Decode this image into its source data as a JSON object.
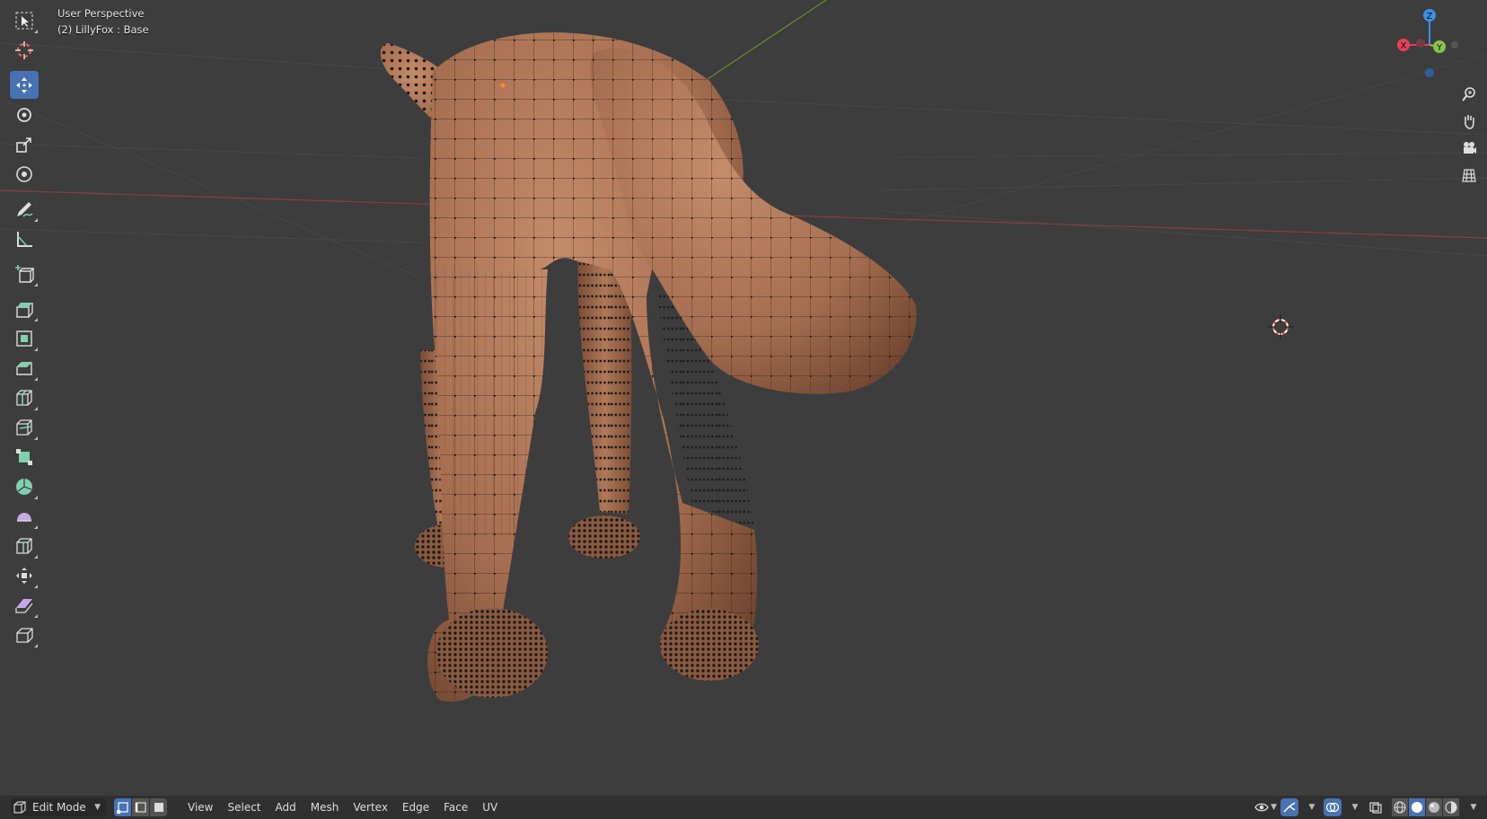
{
  "viewport": {
    "perspective_label": "User Perspective",
    "object_label": "(2) LillyFox : Base"
  },
  "toolbar": {
    "tools": [
      {
        "name": "select-box-tool",
        "icon": "cursor-box-icon",
        "active": false
      },
      {
        "name": "cursor-tool",
        "icon": "cursor-3d-icon",
        "active": false
      },
      {
        "name": "move-tool",
        "icon": "move-icon",
        "active": true
      },
      {
        "name": "rotate-tool",
        "icon": "rotate-icon",
        "active": false
      },
      {
        "name": "scale-tool",
        "icon": "scale-icon",
        "active": false
      },
      {
        "name": "transform-tool",
        "icon": "transform-icon",
        "active": false
      },
      {
        "name": "annotate-tool",
        "icon": "annotate-icon",
        "active": false
      },
      {
        "name": "measure-tool",
        "icon": "measure-icon",
        "active": false
      },
      {
        "name": "add-cube-tool",
        "icon": "add-cube-icon",
        "active": false
      },
      {
        "name": "extrude-region-tool",
        "icon": "extrude-icon",
        "active": false
      },
      {
        "name": "inset-faces-tool",
        "icon": "inset-icon",
        "active": false
      },
      {
        "name": "bevel-tool",
        "icon": "bevel-icon",
        "active": false
      },
      {
        "name": "loop-cut-tool",
        "icon": "loop-cut-icon",
        "active": false
      },
      {
        "name": "knife-tool",
        "icon": "knife-icon",
        "active": false
      },
      {
        "name": "poly-build-tool",
        "icon": "poly-build-icon",
        "active": false
      },
      {
        "name": "spin-tool",
        "icon": "spin-icon",
        "active": false
      },
      {
        "name": "smooth-tool",
        "icon": "smooth-icon",
        "active": false
      },
      {
        "name": "edge-slide-tool",
        "icon": "edge-slide-icon",
        "active": false
      },
      {
        "name": "shrink-fatten-tool",
        "icon": "shrink-fatten-icon",
        "active": false
      },
      {
        "name": "shear-tool",
        "icon": "shear-icon",
        "active": false
      },
      {
        "name": "rip-region-tool",
        "icon": "rip-icon",
        "active": false
      }
    ]
  },
  "gizmo": {
    "x_label": "X",
    "y_label": "Y",
    "z_label": "Z",
    "x_color": "#e8405a",
    "y_color": "#8bc34a",
    "z_color": "#3f8ee8"
  },
  "nav_buttons": [
    "zoom-icon",
    "pan-hand-icon",
    "camera-icon",
    "grid-ortho-icon"
  ],
  "header": {
    "mode": "Edit Mode",
    "select_modes": [
      "vertex-select-icon",
      "edge-select-icon",
      "face-select-icon"
    ],
    "menus": [
      "View",
      "Select",
      "Add",
      "Mesh",
      "Vertex",
      "Edge",
      "Face",
      "UV"
    ]
  },
  "colors": {
    "background": "#3d3d3d",
    "mesh": "#b07858",
    "accent": "#4772b3",
    "header": "#303030"
  }
}
